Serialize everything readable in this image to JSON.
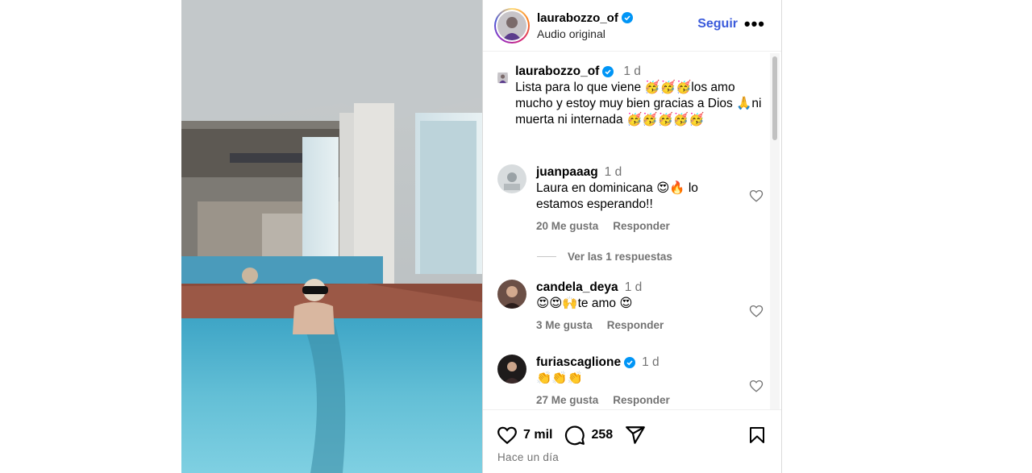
{
  "post": {
    "username": "laurabozzo_of",
    "subtitle": "Audio original",
    "follow_label": "Seguir",
    "more_label": "•••"
  },
  "caption": {
    "username": "laurabozzo_of",
    "time": "1 d",
    "text": "Lista para lo que viene 🥳🥳🥳los amo mucho y estoy muy bien gracias a Dios 🙏ni muerta ni internada 🥳🥳🥳🥳🥳"
  },
  "comments": [
    {
      "username": "juanpaaag",
      "time": "1 d",
      "text": "Laura en dominicana 😍🔥 lo estamos esperando!!",
      "likes": "20 Me gusta",
      "reply": "Responder",
      "verified": false
    },
    {
      "username": "candela_deya",
      "time": "1 d",
      "text": "😍😍🙌te amo 😍",
      "likes": "3 Me gusta",
      "reply": "Responder",
      "verified": false
    },
    {
      "username": "furiascaglione",
      "time": "1 d",
      "text": "👏👏👏",
      "likes": "27 Me gusta",
      "reply": "Responder",
      "verified": true
    }
  ],
  "view_replies": "Ver las 1 respuestas",
  "actions": {
    "likes": "7 mil",
    "comments": "258",
    "posted": "Hace un día"
  },
  "icons": [
    "heart-icon",
    "comment-icon",
    "share-icon",
    "bookmark-icon",
    "verified-icon",
    "more-icon"
  ],
  "colors": {
    "link_blue": "#3b5bdb",
    "verified_blue": "#0095f6",
    "muted": "#737373",
    "pool": "#5ab7cf"
  }
}
